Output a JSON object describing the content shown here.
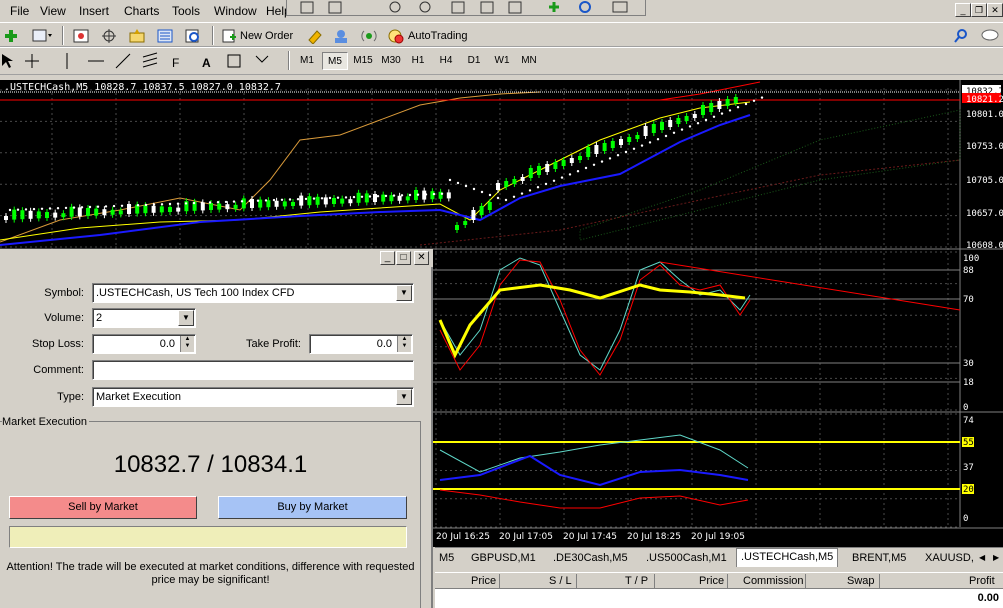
{
  "menu": [
    "File",
    "View",
    "Insert",
    "Charts",
    "Tools",
    "Window",
    "Help"
  ],
  "toolbar": {
    "new_order": "New Order",
    "autotrading": "AutoTrading"
  },
  "timeframes": [
    "M1",
    "M5",
    "M15",
    "M30",
    "H1",
    "H4",
    "D1",
    "W1",
    "MN"
  ],
  "active_timeframe": "M5",
  "chart": {
    "header": ".USTECHCash,M5  10828.7 10837.5 10827.0 10832.7",
    "price_labels": [
      "10832.7",
      "10821.2",
      "10801.0",
      "10753.0",
      "10705.0",
      "10657.0",
      "10608.0"
    ],
    "ind1_labels": [
      "100",
      "88",
      "70",
      "30",
      "18",
      "0"
    ],
    "ind2_labels": [
      "74",
      "55",
      "37",
      "20",
      "0"
    ],
    "time_labels": [
      "20 Jul 16:25",
      "20 Jul 17:05",
      "20 Jul 17:45",
      "20 Jul 18:25",
      "20 Jul 19:05"
    ],
    "colors": {
      "bg": "#000000",
      "grid": "#4a4a4a",
      "bull": "#00ff00",
      "bear": "#ffffff",
      "yellow": "#ffff00",
      "red": "#ff0000",
      "cyan": "#5fd7c8",
      "blue": "#1a1aff"
    }
  },
  "dialog": {
    "symbol_label": "Symbol:",
    "symbol_value": ".USTECHCash, US Tech 100 Index CFD",
    "volume_label": "Volume:",
    "volume_value": "2",
    "stoploss_label": "Stop Loss:",
    "stoploss_value": "0.0",
    "takeprofit_label": "Take Profit:",
    "takeprofit_value": "0.0",
    "comment_label": "Comment:",
    "comment_value": "",
    "type_label": "Type:",
    "type_value": "Market Execution",
    "group_label": "Market Execution",
    "price": "10832.7 / 10834.1",
    "sell_button": "Sell by Market",
    "buy_button": "Buy by Market",
    "attention": "Attention! The trade will be executed at market conditions, difference with requested price may be significant!"
  },
  "tabs": [
    "M5",
    "GBPUSD,M1",
    ".DE30Cash,M5",
    ".US500Cash,M1",
    ".USTECHCash,M5",
    "BRENT,M5",
    "XAUUSD,"
  ],
  "active_tab": ".USTECHCash,M5",
  "terminal": {
    "columns": [
      "Price",
      "S / L",
      "T / P",
      "Price",
      "Commission",
      "Swap",
      "Profit"
    ],
    "profit_total": "0.00"
  }
}
